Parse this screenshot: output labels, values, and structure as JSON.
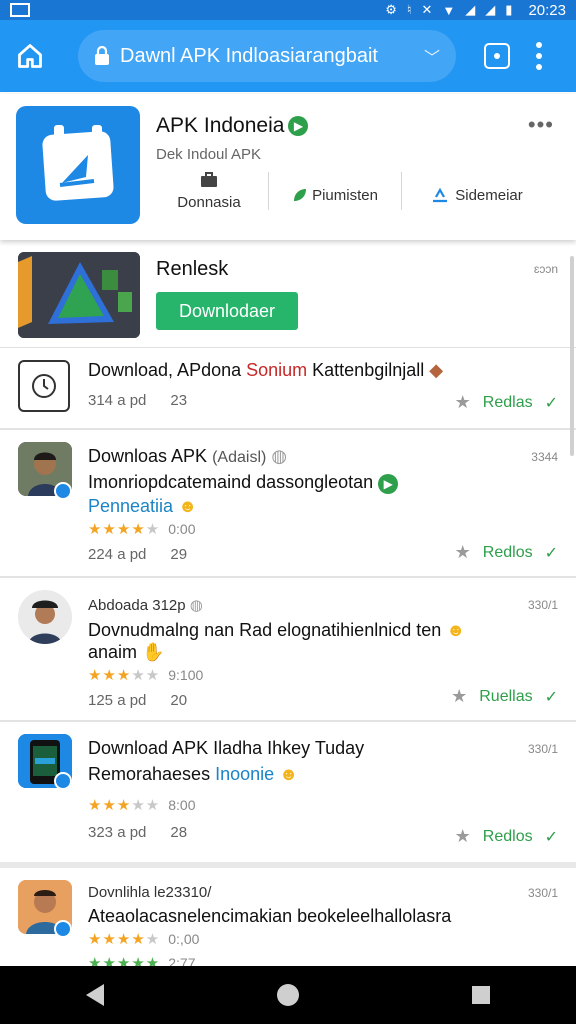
{
  "status_bar": {
    "time": "20:23"
  },
  "topbar": {
    "url": "Dawnl APK Indloasiarangbait"
  },
  "header": {
    "title": "APK Indoneia",
    "subtitle": "Dek Indoul APK",
    "more": "•••",
    "actions": [
      {
        "label": "Donnasia",
        "icon": "briefcase-icon"
      },
      {
        "label": "Piumisten",
        "icon": "leaf-icon",
        "top": "↕"
      },
      {
        "label": "Sidemeiar",
        "icon": "share-icon"
      }
    ]
  },
  "feature": {
    "title": "Renlesk",
    "meta": "ɛɔɔn",
    "download_label": "Downlodaer"
  },
  "rows": [
    {
      "title_pre": "Download, APdona ",
      "title_red": "Sonium",
      "title_post": " Kattenbgilnjall",
      "stats_a": "314 a pd",
      "stats_b": "23",
      "action": "Redlas"
    },
    {
      "title": "Downloas APK",
      "title_muted": "(Adaisl)",
      "count": "3344",
      "line2": "Imonriopdcatemaind dassongleotan",
      "line3": "Penneatiia",
      "rating": "0:00",
      "stats_a": "224 a pd",
      "stats_b": "29",
      "action": "Redlos"
    },
    {
      "title": "Abdoada 312p",
      "count": "330/1",
      "line2": "Dovnudmalng nan Rad elognatihienlnicd ten",
      "line3": "anaim",
      "rating": "9:100",
      "stats_a": "125 a pd",
      "stats_b": "20",
      "action": "Ruellas"
    },
    {
      "title": "Download APK Iladha Ihkey Tuday",
      "count": "330/1",
      "line2": "Remorahaeses ",
      "line2_blue": "Inoonie",
      "rating": "8:00",
      "stats_a": "323 a pd",
      "stats_b": "28",
      "action": "Redlos"
    },
    {
      "title": "Dovnlihla le23310/",
      "count": "330/1",
      "line2": "Ateaolacasnelencimakian beokeleelhallolasra",
      "rating": "0:,00",
      "rating2": "2:77"
    }
  ],
  "colors": {
    "primary": "#2196f3",
    "accent_green": "#26b56b",
    "star": "#f3a423",
    "link_blue": "#1b84c6"
  }
}
